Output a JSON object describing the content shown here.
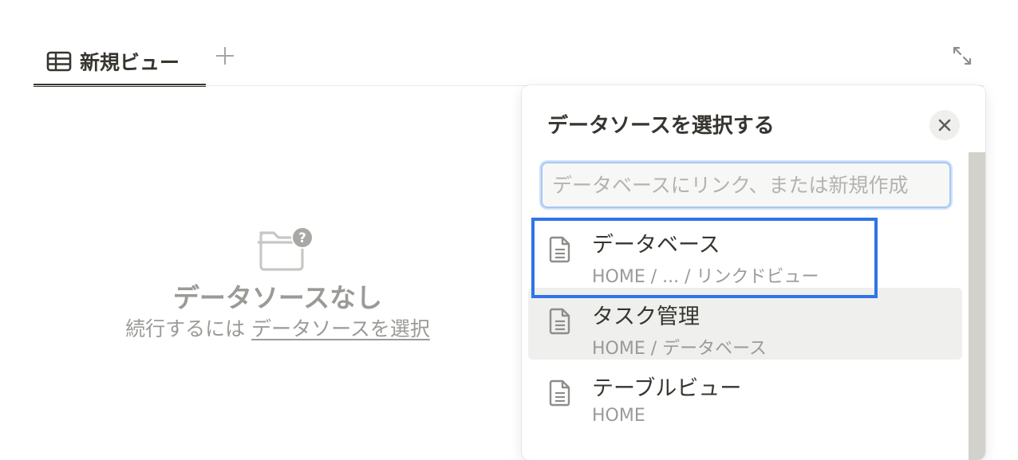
{
  "tabs": [
    {
      "label": "新規ビュー",
      "icon": "table-icon",
      "active": true
    }
  ],
  "toolbar": {
    "add_view_icon": "plus-icon",
    "expand_icon": "expand-icon"
  },
  "empty_state": {
    "icon": "folder-question-icon",
    "title": "データソースなし",
    "subtitle_prefix": "続行するには",
    "subtitle_link": "データソースを選択"
  },
  "popup": {
    "title": "データソースを選択する",
    "close_icon": "close-icon",
    "search": {
      "value": "",
      "placeholder": "データベースにリンク、または新規作成"
    },
    "results": [
      {
        "title": "データベース",
        "path": "HOME / ... / リンクドビュー",
        "icon": "document-icon",
        "highlighted": true
      },
      {
        "title": "タスク管理",
        "path": "HOME / データベース",
        "icon": "document-icon",
        "hovered": true
      },
      {
        "title": "テーブルビュー",
        "path": "HOME",
        "icon": "document-icon"
      }
    ]
  },
  "colors": {
    "text": "#37352f",
    "muted": "#9b9a97",
    "highlight_border": "#2f74e8",
    "hover_bg": "#efefed"
  }
}
